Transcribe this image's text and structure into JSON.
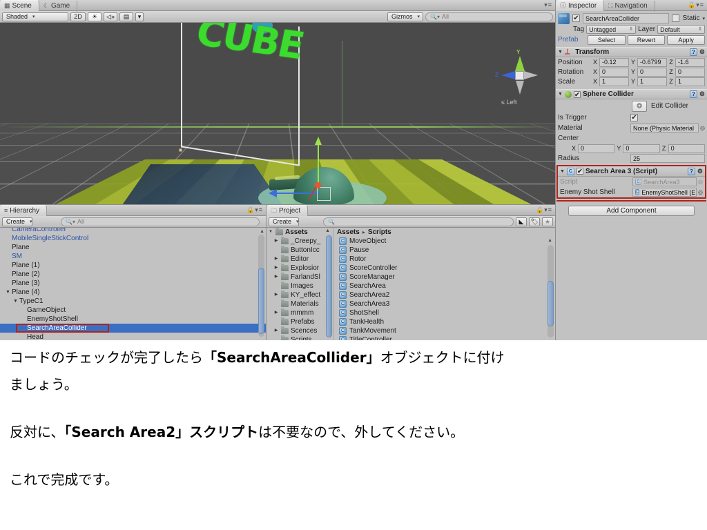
{
  "scene_view": {
    "tabs": [
      {
        "label": "Scene",
        "icon": "grid-icon",
        "active": true
      },
      {
        "label": "Game",
        "icon": "gamepad-icon",
        "active": false
      }
    ],
    "toolbar": {
      "draw_mode": "Shaded",
      "two_d": "2D",
      "lighting_icon": "sun-icon",
      "audio_icon": "speaker-icon",
      "fx_icon": "image-icon",
      "gizmos": "Gizmos",
      "search_placeholder": "All"
    },
    "billboard_text": "CUBE",
    "orientation_gizmo": {
      "y_label": "Y",
      "z_label": "Z",
      "caption": "Left"
    }
  },
  "inspector": {
    "tabs": [
      {
        "label": "Inspector",
        "icon": "info-icon",
        "active": true
      },
      {
        "label": "Navigation",
        "icon": "navigation-icon",
        "active": false
      }
    ],
    "object_name": "SearchAreaCollider",
    "object_enabled": true,
    "static_label": "Static",
    "tag_label": "Tag",
    "tag_value": "Untagged",
    "layer_label": "Layer",
    "layer_value": "Default",
    "prefab_label": "Prefab",
    "prefab_buttons": [
      "Select",
      "Revert",
      "Apply"
    ],
    "transform": {
      "title": "Transform",
      "rows": [
        {
          "label": "Position",
          "x": "-0.12",
          "y": "-0.6799",
          "z": "-1.6"
        },
        {
          "label": "Rotation",
          "x": "0",
          "y": "0",
          "z": "0"
        },
        {
          "label": "Scale",
          "x": "1",
          "y": "1",
          "z": "1"
        }
      ],
      "axes": [
        "X",
        "Y",
        "Z"
      ]
    },
    "sphere_collider": {
      "title": "Sphere Collider",
      "enabled": true,
      "edit_collider_label": "Edit Collider",
      "is_trigger_label": "Is Trigger",
      "is_trigger_value": true,
      "material_label": "Material",
      "material_value": "None (Physic Material",
      "center_label": "Center",
      "center_x": "0",
      "center_y": "0",
      "center_z": "0",
      "radius_label": "Radius",
      "radius_value": "25"
    },
    "script_component": {
      "title": "Search Area 3 (Script)",
      "enabled": true,
      "script_label": "Script",
      "script_value": "SearchArea3",
      "field_label": "Enemy Shot Shell",
      "field_value": "EnemyShotShell (En",
      "highlight_color": "#b02318"
    },
    "add_component_label": "Add Component"
  },
  "hierarchy": {
    "tab_label": "Hierarchy",
    "tab_icon": "list-icon",
    "create_label": "Create",
    "search_placeholder": "All",
    "items": [
      {
        "label": "CameraController",
        "indent": 0,
        "prefab": true,
        "arrow": "",
        "selected": false,
        "clipped": true
      },
      {
        "label": "MobileSingleStickControl",
        "indent": 0,
        "prefab": true,
        "arrow": "",
        "selected": false
      },
      {
        "label": "Plane",
        "indent": 0,
        "prefab": false,
        "arrow": "",
        "selected": false
      },
      {
        "label": "SM",
        "indent": 0,
        "prefab": true,
        "arrow": "",
        "selected": false
      },
      {
        "label": "Plane (1)",
        "indent": 0,
        "prefab": false,
        "arrow": "",
        "selected": false
      },
      {
        "label": "Plane (2)",
        "indent": 0,
        "prefab": false,
        "arrow": "",
        "selected": false
      },
      {
        "label": "Plane (3)",
        "indent": 0,
        "prefab": false,
        "arrow": "",
        "selected": false
      },
      {
        "label": "Plane (4)",
        "indent": 0,
        "prefab": false,
        "arrow": "▼",
        "selected": false
      },
      {
        "label": "TypeC1",
        "indent": 1,
        "prefab": false,
        "arrow": "▼",
        "selected": false
      },
      {
        "label": "GameObject",
        "indent": 2,
        "prefab": false,
        "arrow": "",
        "selected": false
      },
      {
        "label": "EnemyShotShell",
        "indent": 2,
        "prefab": false,
        "arrow": "",
        "selected": false
      },
      {
        "label": "SearchAreaCollider",
        "indent": 2,
        "prefab": false,
        "arrow": "",
        "selected": true
      },
      {
        "label": "Head",
        "indent": 2,
        "prefab": false,
        "arrow": "",
        "selected": false
      }
    ]
  },
  "project": {
    "tab_label": "Project",
    "tab_icon": "folder-icon",
    "create_label": "Create",
    "search_placeholder": "",
    "toolbar_icons": [
      "filter-by-type-icon",
      "filter-by-label-icon",
      "favorites-star-icon"
    ],
    "tree_root": "Assets",
    "tree_items": [
      {
        "label": "_Creepy_",
        "expandable": true
      },
      {
        "label": "ButtonIcc",
        "expandable": false
      },
      {
        "label": "Editor",
        "expandable": true
      },
      {
        "label": "Explosior",
        "expandable": true
      },
      {
        "label": "FarlandSl",
        "expandable": true
      },
      {
        "label": "Images",
        "expandable": false
      },
      {
        "label": "KY_effect",
        "expandable": true
      },
      {
        "label": "Materials",
        "expandable": false
      },
      {
        "label": "mmmm",
        "expandable": true
      },
      {
        "label": "Prefabs",
        "expandable": false
      },
      {
        "label": "Scences",
        "expandable": true
      },
      {
        "label": "Scripts",
        "expandable": false
      }
    ],
    "breadcrumb": [
      "Assets",
      "Scripts"
    ],
    "assets": [
      "MoveObject",
      "Pause",
      "Rotor",
      "ScoreController",
      "ScoreManager",
      "SearchArea",
      "SearchArea2",
      "SearchArea3",
      "ShotShell",
      "TankHealth",
      "TankMovement",
      "TitleController"
    ]
  },
  "caption": {
    "line1_a": "コードのチェックが完了したら",
    "line1_b": "「SearchAreaCollider」",
    "line1_c": "オブジェクトに付け",
    "line2": "ましょう。",
    "line3_a": "反対に、",
    "line3_b": "「Search Area2」スクリプト",
    "line3_c": "は不要なので、外してください。",
    "line4": "これで完成です。"
  }
}
